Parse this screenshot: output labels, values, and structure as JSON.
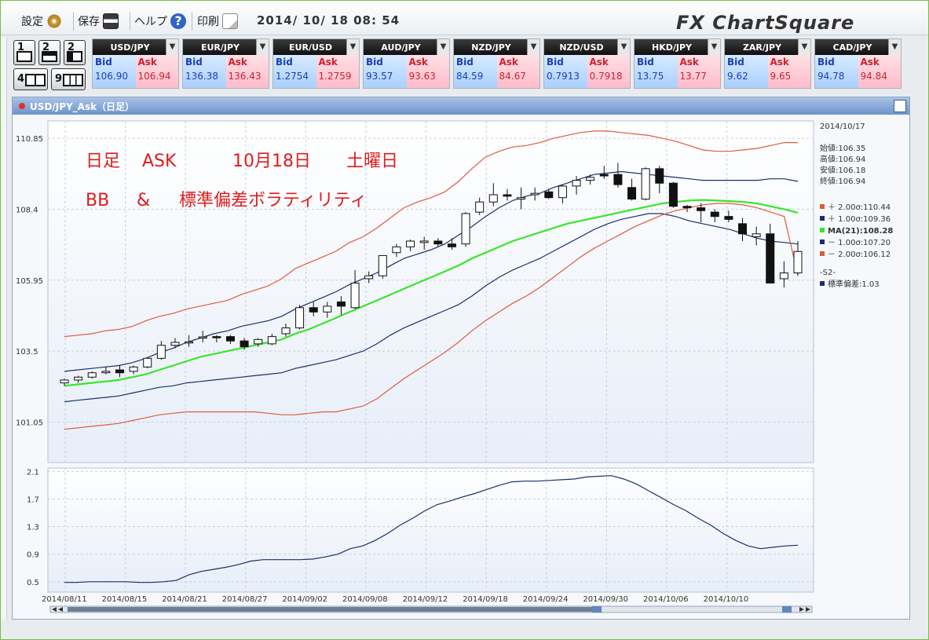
{
  "toolbar": {
    "settings_label": "設定",
    "save_label": "保存",
    "help_label": "ヘルプ",
    "print_label": "印刷",
    "datetime": "2014/ 10/ 18  08: 54",
    "logo": "FX ChartSquare"
  },
  "layout_buttons": [
    "1",
    "2",
    "2",
    "4",
    "9"
  ],
  "pairs": [
    {
      "name": "USD/JPY",
      "bid": "106.90",
      "ask": "106.94"
    },
    {
      "name": "EUR/JPY",
      "bid": "136.38",
      "ask": "136.43"
    },
    {
      "name": "EUR/USD",
      "bid": "1.2754",
      "ask": "1.2759"
    },
    {
      "name": "AUD/JPY",
      "bid": "93.57",
      "ask": "93.63"
    },
    {
      "name": "NZD/JPY",
      "bid": "84.59",
      "ask": "84.67"
    },
    {
      "name": "NZD/USD",
      "bid": "0.7913",
      "ask": "0.7918"
    },
    {
      "name": "HKD/JPY",
      "bid": "13.75",
      "ask": "13.77"
    },
    {
      "name": "ZAR/JPY",
      "bid": "9.62",
      "ask": "9.65"
    },
    {
      "name": "CAD/JPY",
      "bid": "94.78",
      "ask": "94.84"
    }
  ],
  "labels": {
    "bid": "Bid",
    "ask": "Ask"
  },
  "chart": {
    "window_title": "USD/JPY_Ask（日足）",
    "annotation_line1_parts": [
      "日足",
      "ASK",
      "10月18日",
      "土曜日"
    ],
    "annotation_line2_parts": [
      "BB",
      "&",
      "標準偏差ボラティリティ"
    ],
    "info": {
      "date": "2014/10/17",
      "ohlc": [
        "始値:106.35",
        "高値:106.94",
        "安値:106.18",
        "終値:106.94"
      ],
      "legend": [
        {
          "label": "＋ 2.00σ:110.44",
          "color": "#e05a3c"
        },
        {
          "label": "＋ 1.00σ:109.36",
          "color": "#1a2f6e"
        },
        {
          "label": "MA(21):108.28",
          "color": "#37e62a"
        },
        {
          "label": "－ 1.00σ:107.20",
          "color": "#1a2f6e"
        },
        {
          "label": "－ 2.00σ:106.12",
          "color": "#e05a3c"
        }
      ],
      "sub_title": "-S2-",
      "sub_legend": {
        "label": "標準偏差:1.03",
        "color": "#1a2f6e"
      }
    }
  },
  "chart_data": [
    {
      "type": "candlestick",
      "title": "",
      "x_ticks": [
        "2014/08/11",
        "2014/08/15",
        "2014/08/21",
        "2014/08/27",
        "2014/09/02",
        "2014/09/08",
        "2014/09/12",
        "2014/09/18",
        "2014/09/24",
        "2014/09/30",
        "2014/10/06",
        "2014/10/10"
      ],
      "y_ticks": [
        101.05,
        103.5,
        105.95,
        108.4,
        110.85
      ],
      "ylim": [
        99.65,
        111.45
      ],
      "candles": [
        [
          102.4,
          102.55,
          102.3,
          102.5
        ],
        [
          102.5,
          102.65,
          102.4,
          102.6
        ],
        [
          102.6,
          102.8,
          102.55,
          102.75
        ],
        [
          102.75,
          102.95,
          102.7,
          102.8
        ],
        [
          102.85,
          103.0,
          102.6,
          102.75
        ],
        [
          102.8,
          103.0,
          102.7,
          102.95
        ],
        [
          102.95,
          103.3,
          102.9,
          103.25
        ],
        [
          103.25,
          103.85,
          103.2,
          103.7
        ],
        [
          103.7,
          103.95,
          103.6,
          103.8
        ],
        [
          103.8,
          104.05,
          103.65,
          103.82
        ],
        [
          103.95,
          104.2,
          103.8,
          103.99
        ],
        [
          104.0,
          104.05,
          103.8,
          103.98
        ],
        [
          104.0,
          104.05,
          103.75,
          103.85
        ],
        [
          103.85,
          103.95,
          103.55,
          103.65
        ],
        [
          103.75,
          103.95,
          103.65,
          103.9
        ],
        [
          103.75,
          104.1,
          103.7,
          104.0
        ],
        [
          104.1,
          104.45,
          104.0,
          104.3
        ],
        [
          104.3,
          105.1,
          104.25,
          105.0
        ],
        [
          105.0,
          105.2,
          104.7,
          104.85
        ],
        [
          104.85,
          105.2,
          104.65,
          105.05
        ],
        [
          105.2,
          105.4,
          104.75,
          105.05
        ],
        [
          105.0,
          106.3,
          104.95,
          105.85
        ],
        [
          106.0,
          106.25,
          105.85,
          106.1
        ],
        [
          106.1,
          106.8,
          106.0,
          106.8
        ],
        [
          106.9,
          107.2,
          106.75,
          107.1
        ],
        [
          107.1,
          107.35,
          106.95,
          107.3
        ],
        [
          107.25,
          107.45,
          107.0,
          107.3
        ],
        [
          107.3,
          107.4,
          107.1,
          107.2
        ],
        [
          107.2,
          107.4,
          107.0,
          107.1
        ],
        [
          107.2,
          108.3,
          107.1,
          108.25
        ],
        [
          108.3,
          108.8,
          108.2,
          108.65
        ],
        [
          108.65,
          109.3,
          108.5,
          108.9
        ],
        [
          108.9,
          109.1,
          108.7,
          108.85
        ],
        [
          108.75,
          109.15,
          108.4,
          108.8
        ],
        [
          108.9,
          109.15,
          108.7,
          108.95
        ],
        [
          109.0,
          109.1,
          108.75,
          108.8
        ],
        [
          108.8,
          109.25,
          108.6,
          109.2
        ],
        [
          109.2,
          109.55,
          108.9,
          109.4
        ],
        [
          109.4,
          109.6,
          109.25,
          109.5
        ],
        [
          109.6,
          109.9,
          109.45,
          109.55
        ],
        [
          109.6,
          110.0,
          109.15,
          109.25
        ],
        [
          109.15,
          109.45,
          108.7,
          108.75
        ],
        [
          108.75,
          109.85,
          108.7,
          109.8
        ],
        [
          109.8,
          109.9,
          108.95,
          109.3
        ],
        [
          109.3,
          109.35,
          108.45,
          108.5
        ],
        [
          108.5,
          108.55,
          108.3,
          108.45
        ],
        [
          108.45,
          108.6,
          107.95,
          108.35
        ],
        [
          108.3,
          108.4,
          107.95,
          108.15
        ],
        [
          108.15,
          108.35,
          107.95,
          108.05
        ],
        [
          107.9,
          108.1,
          107.3,
          107.55
        ],
        [
          107.45,
          107.8,
          107.15,
          107.55
        ],
        [
          107.55,
          107.9,
          105.95,
          105.85
        ],
        [
          106.0,
          106.6,
          105.7,
          106.2
        ],
        [
          106.2,
          107.3,
          106.1,
          106.94
        ]
      ],
      "series": [
        {
          "name": "＋ 2.00σ",
          "color": "#e05a3c",
          "values": [
            104.0,
            104.05,
            104.1,
            104.2,
            104.25,
            104.35,
            104.55,
            104.7,
            104.8,
            104.95,
            105.05,
            105.15,
            105.25,
            105.45,
            105.6,
            105.75,
            106.0,
            106.35,
            106.55,
            106.75,
            106.95,
            107.25,
            107.45,
            107.75,
            108.1,
            108.45,
            108.65,
            108.8,
            109.0,
            109.35,
            109.8,
            110.2,
            110.4,
            110.55,
            110.6,
            110.7,
            110.85,
            110.95,
            111.05,
            111.1,
            111.1,
            111.05,
            111.0,
            110.95,
            110.85,
            110.75,
            110.6,
            110.45,
            110.4,
            110.4,
            110.45,
            110.5,
            110.6,
            110.7,
            110.7
          ]
        },
        {
          "name": "＋ 1.00σ",
          "color": "#1a2f6e",
          "values": [
            102.8,
            102.85,
            102.9,
            102.95,
            103.0,
            103.1,
            103.25,
            103.45,
            103.6,
            103.8,
            103.95,
            104.1,
            104.2,
            104.35,
            104.45,
            104.55,
            104.7,
            104.95,
            105.15,
            105.35,
            105.55,
            105.8,
            106.0,
            106.2,
            106.45,
            106.7,
            106.85,
            107.0,
            107.2,
            107.5,
            107.8,
            108.15,
            108.45,
            108.7,
            108.85,
            108.95,
            109.15,
            109.3,
            109.45,
            109.6,
            109.65,
            109.7,
            109.65,
            109.6,
            109.55,
            109.5,
            109.45,
            109.4,
            109.4,
            109.4,
            109.4,
            109.4,
            109.45,
            109.45,
            109.36
          ]
        },
        {
          "name": "MA(21)",
          "color": "#37e62a",
          "values": [
            102.3,
            102.35,
            102.4,
            102.45,
            102.5,
            102.6,
            102.7,
            102.85,
            103.0,
            103.15,
            103.3,
            103.4,
            103.5,
            103.6,
            103.7,
            103.8,
            103.9,
            104.1,
            104.25,
            104.45,
            104.65,
            104.85,
            105.05,
            105.25,
            105.45,
            105.65,
            105.85,
            106.05,
            106.25,
            106.45,
            106.7,
            106.9,
            107.1,
            107.3,
            107.45,
            107.6,
            107.75,
            107.9,
            108.0,
            108.1,
            108.2,
            108.3,
            108.4,
            108.5,
            108.6,
            108.65,
            108.7,
            108.72,
            108.7,
            108.68,
            108.65,
            108.6,
            108.5,
            108.4,
            108.28
          ]
        },
        {
          "name": "－ 1.00σ",
          "color": "#1a2f6e",
          "values": [
            101.75,
            101.8,
            101.85,
            101.9,
            101.95,
            102.05,
            102.15,
            102.25,
            102.3,
            102.4,
            102.45,
            102.5,
            102.55,
            102.6,
            102.65,
            102.7,
            102.75,
            102.9,
            103.0,
            103.1,
            103.2,
            103.35,
            103.5,
            103.75,
            104.05,
            104.3,
            104.5,
            104.7,
            104.9,
            105.1,
            105.4,
            105.75,
            106.05,
            106.3,
            106.5,
            106.7,
            106.95,
            107.2,
            107.45,
            107.7,
            107.9,
            108.05,
            108.15,
            108.25,
            108.25,
            108.15,
            108.0,
            107.9,
            107.8,
            107.7,
            107.55,
            107.4,
            107.3,
            107.25,
            107.2
          ]
        },
        {
          "name": "－ 2.00σ",
          "color": "#e05a3c",
          "values": [
            100.8,
            100.85,
            100.9,
            100.95,
            101.0,
            101.1,
            101.2,
            101.3,
            101.35,
            101.4,
            101.4,
            101.4,
            101.4,
            101.4,
            101.4,
            101.35,
            101.3,
            101.3,
            101.35,
            101.4,
            101.4,
            101.5,
            101.6,
            101.85,
            102.2,
            102.55,
            102.85,
            103.15,
            103.45,
            103.8,
            104.2,
            104.55,
            104.85,
            105.15,
            105.4,
            105.7,
            106.05,
            106.4,
            106.75,
            107.05,
            107.3,
            107.55,
            107.8,
            108.0,
            108.2,
            108.35,
            108.45,
            108.55,
            108.6,
            108.6,
            108.55,
            108.45,
            108.3,
            108.15,
            106.12
          ]
        }
      ]
    },
    {
      "type": "line",
      "title": "",
      "y_ticks": [
        0.5,
        0.9,
        1.3,
        1.7,
        2.1
      ],
      "ylim": [
        0.35,
        2.15
      ],
      "series": [
        {
          "name": "標準偏差",
          "color": "#1a2f6e",
          "values": [
            0.49,
            0.49,
            0.5,
            0.5,
            0.5,
            0.5,
            0.49,
            0.49,
            0.5,
            0.52,
            0.6,
            0.65,
            0.68,
            0.71,
            0.75,
            0.8,
            0.82,
            0.82,
            0.82,
            0.82,
            0.83,
            0.86,
            0.9,
            0.98,
            1.02,
            1.1,
            1.2,
            1.32,
            1.42,
            1.53,
            1.62,
            1.67,
            1.73,
            1.78,
            1.84,
            1.9,
            1.95,
            1.96,
            1.96,
            1.97,
            1.98,
            1.99,
            2.02,
            2.03,
            2.04,
            1.99,
            1.92,
            1.82,
            1.72,
            1.62,
            1.53,
            1.42,
            1.32,
            1.2,
            1.1,
            1.02,
            0.98,
            1.0,
            1.02,
            1.03
          ]
        }
      ]
    }
  ]
}
